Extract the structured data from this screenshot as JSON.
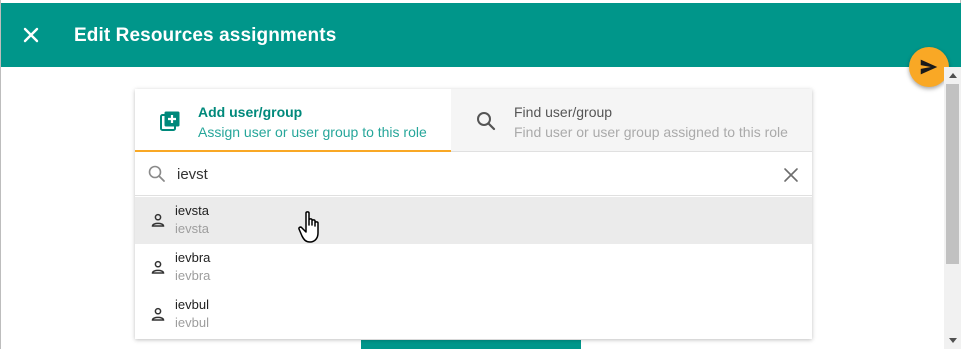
{
  "dialog": {
    "title": "Edit Resources assignments",
    "close_icon": "close-icon",
    "send_icon": "send-icon"
  },
  "tabs": [
    {
      "title": "Add user/group",
      "subtitle": "Assign user or user group to this role",
      "icon": "add-box-icon",
      "active": true
    },
    {
      "title": "Find user/group",
      "subtitle": "Find user or user group assigned to this role",
      "icon": "search-icon",
      "active": false
    }
  ],
  "search": {
    "value": "ievst",
    "clear_icon": "close-icon"
  },
  "results": [
    {
      "name": "ievsta",
      "login": "ievsta",
      "hovered": true
    },
    {
      "name": "ievbra",
      "login": "ievbra",
      "hovered": false
    },
    {
      "name": "ievbul",
      "login": "ievbul",
      "hovered": false
    }
  ],
  "colors": {
    "primary": "#00968a",
    "accent": "#f9a825",
    "hover": "#ebebeb"
  }
}
